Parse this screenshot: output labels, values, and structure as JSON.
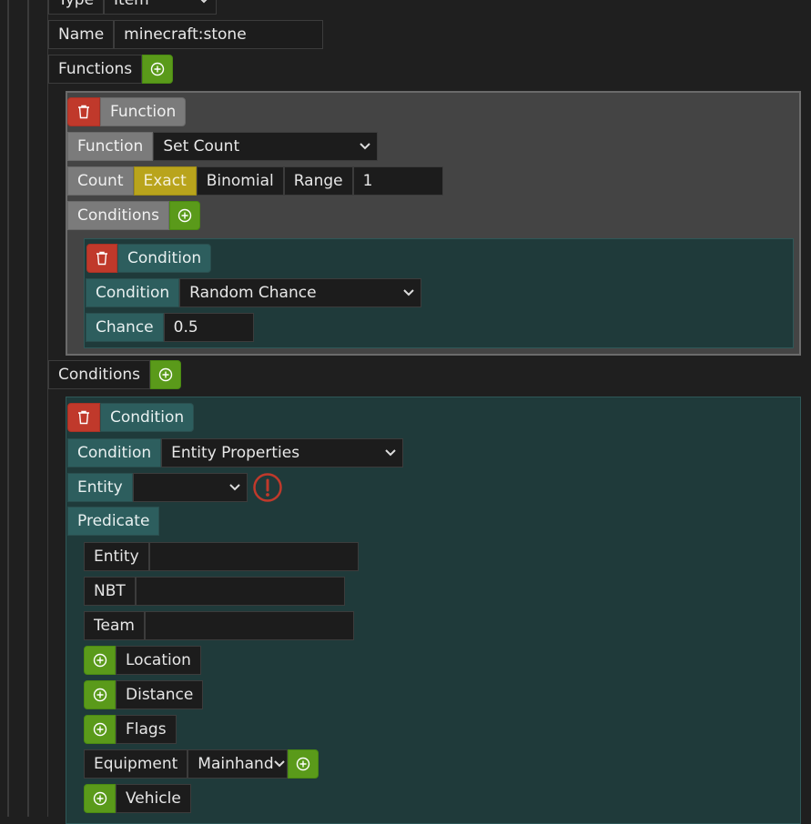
{
  "type_row": {
    "label": "Type",
    "value": "Item"
  },
  "name_row": {
    "label": "Name",
    "value": "minecraft:stone"
  },
  "functions": {
    "label": "Functions"
  },
  "function_block": {
    "header": "Function",
    "function_label": "Function",
    "function_value": "Set Count",
    "count_label": "Count",
    "count_options": [
      "Exact",
      "Binomial",
      "Range"
    ],
    "count_selected": "Exact",
    "count_value": "1",
    "conditions_label": "Conditions",
    "condition": {
      "header": "Condition",
      "condition_label": "Condition",
      "condition_value": "Random Chance",
      "chance_label": "Chance",
      "chance_value": "0.5"
    }
  },
  "conditions": {
    "label": "Conditions",
    "condition": {
      "header": "Condition",
      "condition_label": "Condition",
      "condition_value": "Entity Properties",
      "entity_label": "Entity",
      "entity_value": "",
      "predicate_label": "Predicate",
      "predicate": {
        "entity_label": "Entity",
        "nbt_label": "NBT",
        "team_label": "Team",
        "location_label": "Location",
        "distance_label": "Distance",
        "flags_label": "Flags",
        "equipment_label": "Equipment",
        "equipment_value": "Mainhand",
        "vehicle_label": "Vehicle"
      }
    }
  },
  "colors": {
    "add": "#5a9a1a",
    "delete": "#c0392b",
    "teal": "#2d5e5e",
    "grey": "#7b7b7b",
    "selected": "#b9a41c",
    "error": "#c0392b"
  }
}
